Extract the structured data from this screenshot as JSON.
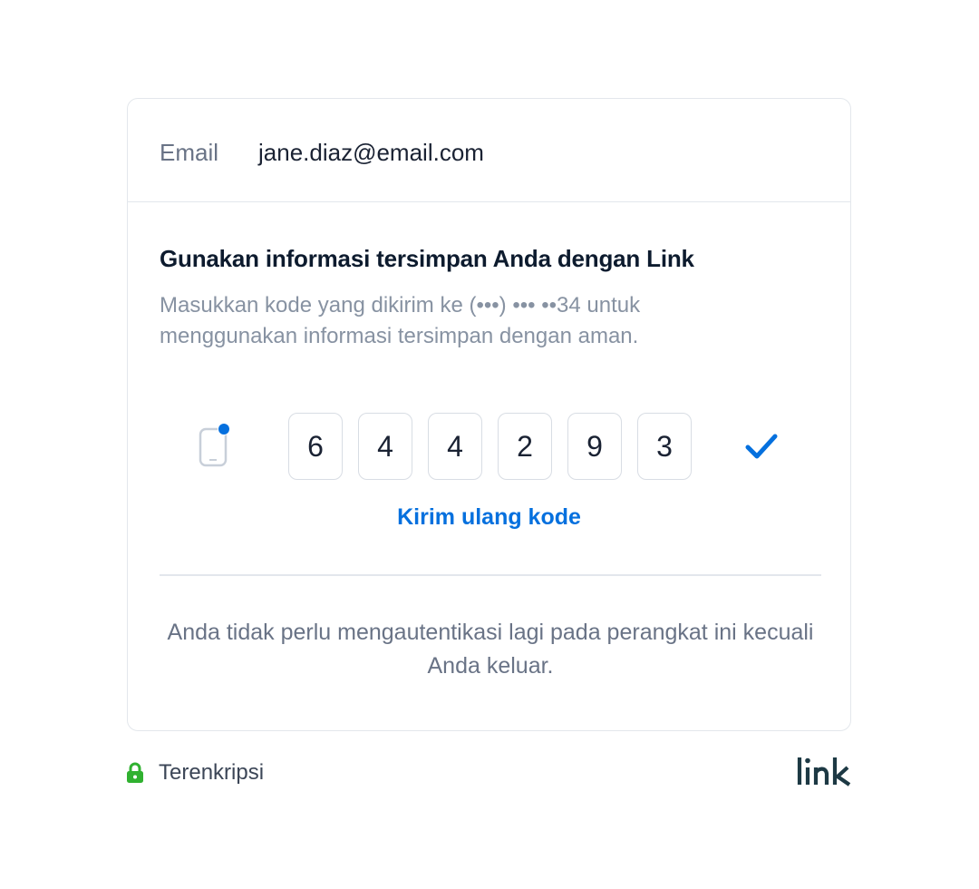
{
  "email": {
    "label": "Email",
    "value": "jane.diaz@email.com"
  },
  "verify": {
    "heading": "Gunakan informasi tersimpan Anda dengan Link",
    "description": "Masukkan kode yang dikirim ke (•••) ••• ••34 untuk menggunakan informasi tersimpan dengan aman.",
    "code_digits": [
      "6",
      "4",
      "4",
      "2",
      "9",
      "3"
    ],
    "resend_label": "Kirim ulang kode",
    "note": "Anda tidak perlu mengautentikasi lagi pada perangkat ini kecuali Anda keluar."
  },
  "footer": {
    "security_label": "Terenkripsi",
    "brand_logo_text": "link"
  },
  "icons": {
    "phone": "phone-notification-icon",
    "check": "checkmark-icon",
    "lock": "lock-icon"
  },
  "colors": {
    "accent": "#0570de",
    "lock_green": "#30b130",
    "brand_dark": "#1d3944",
    "text_primary": "#1a2233",
    "text_secondary": "#8792a2"
  }
}
